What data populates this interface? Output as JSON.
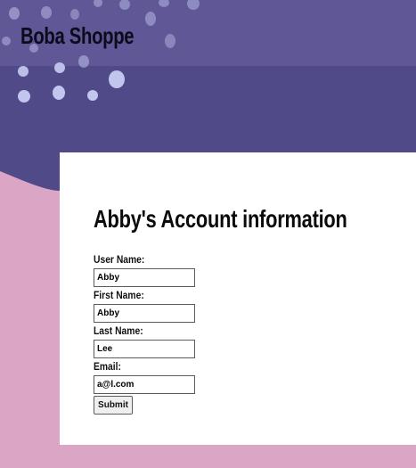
{
  "site": {
    "brand": "Boba Shoppe"
  },
  "colors": {
    "header_purple": "#514a89",
    "header_light": "#5f5796",
    "page_pink": "#dba6c6",
    "bubble": "#c8ccf4",
    "card": "#ffffff"
  },
  "account": {
    "title": "Abby's Account information",
    "fields": [
      {
        "label": "User Name:",
        "value": "Abby"
      },
      {
        "label": "First Name:",
        "value": "Abby"
      },
      {
        "label": "Last Name:",
        "value": "Lee"
      },
      {
        "label": "Email:",
        "value": "a@l.com"
      }
    ],
    "submit_label": "Submit"
  }
}
